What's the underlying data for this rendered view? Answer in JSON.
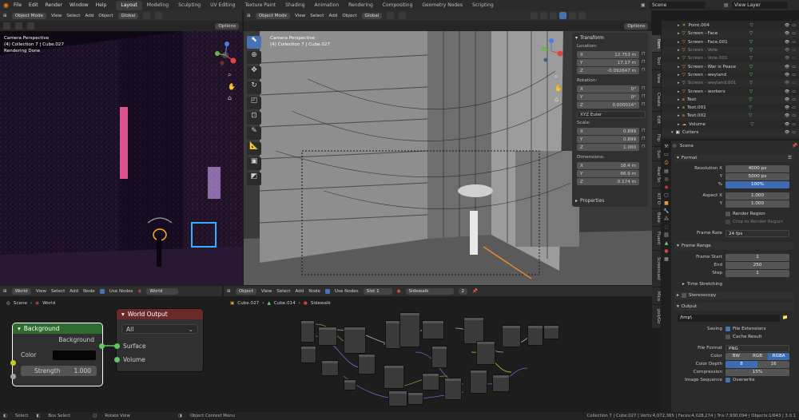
{
  "app": {
    "menu": [
      "File",
      "Edit",
      "Render",
      "Window",
      "Help"
    ],
    "workspaces": [
      "Layout",
      "Modeling",
      "Sculpting",
      "UV Editing",
      "Texture Paint",
      "Shading",
      "Animation",
      "Rendering",
      "Compositing",
      "Geometry Nodes",
      "Scripting"
    ],
    "active_workspace": "Layout",
    "scene": "Scene",
    "view_layer": "View Layer"
  },
  "left_viewport": {
    "mode": "Object Mode",
    "menu": [
      "View",
      "Select",
      "Add",
      "Object"
    ],
    "orientation": "Global",
    "options": "Options",
    "overlay": [
      "Camera Perspective",
      "(4) Collection 7 | Cube.027",
      "Rendering Done"
    ]
  },
  "center_viewport": {
    "mode": "Object Mode",
    "menu": [
      "View",
      "Select",
      "Add",
      "Object"
    ],
    "orientation": "Global",
    "options": "Options",
    "overlay": [
      "Camera Perspective",
      "(4) Collection 7 | Cube.027"
    ],
    "tabs": [
      "Item",
      "Tool",
      "View",
      "Create",
      "Edit",
      "Flip",
      "Sun",
      "Real Sn",
      "KIT O",
      "Bake",
      "Fluent",
      "Screencast",
      "Mica",
      "polyGo"
    ]
  },
  "transform": {
    "title": "Transform",
    "location_label": "Location:",
    "location": [
      {
        "axis": "X",
        "value": "12.753 m"
      },
      {
        "axis": "Y",
        "value": "17.17 m"
      },
      {
        "axis": "Z",
        "value": "-0.092647 m"
      }
    ],
    "rotation_label": "Rotation:",
    "rotation": [
      {
        "axis": "X",
        "value": "0°"
      },
      {
        "axis": "Y",
        "value": "0°"
      },
      {
        "axis": "Z",
        "value": "0.000014°"
      }
    ],
    "rotation_mode": "XYZ Euler",
    "scale_label": "Scale:",
    "scale": [
      {
        "axis": "X",
        "value": "0.899"
      },
      {
        "axis": "Y",
        "value": "0.899"
      },
      {
        "axis": "Z",
        "value": "1.000"
      }
    ],
    "dimensions_label": "Dimensions:",
    "dimensions": [
      {
        "axis": "X",
        "value": "18.4 m"
      },
      {
        "axis": "Y",
        "value": "66.9 m"
      },
      {
        "axis": "Z",
        "value": "0.174 m"
      }
    ],
    "properties": "Properties"
  },
  "outliner": {
    "items": [
      {
        "name": "Point.004",
        "type": "light"
      },
      {
        "name": "Screen - Face",
        "type": "mesh"
      },
      {
        "name": "Screen - Face.001",
        "type": "mesh"
      },
      {
        "name": "Screen - Vote",
        "type": "mesh",
        "dim": true
      },
      {
        "name": "Screen - Vote.001",
        "type": "mesh",
        "dim": true
      },
      {
        "name": "Screen - War is Peace",
        "type": "mesh"
      },
      {
        "name": "Screen - weyland",
        "type": "mesh"
      },
      {
        "name": "Screen - weyland.001",
        "type": "mesh",
        "dim": true
      },
      {
        "name": "Screen - workers",
        "type": "mesh"
      },
      {
        "name": "Text",
        "type": "text"
      },
      {
        "name": "Text.001",
        "type": "text"
      },
      {
        "name": "Text.002",
        "type": "text"
      },
      {
        "name": "Volume",
        "type": "volume"
      },
      {
        "name": "Cutters",
        "type": "collection"
      }
    ]
  },
  "properties": {
    "scene": "Scene",
    "format_title": "Format",
    "resolution_x_label": "Resolution X",
    "resolution_x": "4000 px",
    "y_label": "Y",
    "resolution_y": "5000 px",
    "pct_label": "%",
    "resolution_pct": "100%",
    "aspect_x_label": "Aspect X",
    "aspect_x": "1.000",
    "aspect_y": "1.000",
    "render_region": "Render Region",
    "crop_region": "Crop to Render Region",
    "frame_rate_label": "Frame Rate",
    "frame_rate": "24 fps",
    "frame_range_title": "Frame Range",
    "frame_start_label": "Frame Start",
    "frame_start": "1",
    "end_label": "End",
    "frame_end": "250",
    "step_label": "Step",
    "frame_step": "1",
    "time_stretching": "Time Stretching",
    "stereoscopy": "Stereoscopy",
    "output_title": "Output",
    "output_path": "/tmp\\",
    "saving_label": "Saving",
    "file_extensions": "File Extensions",
    "cache_result": "Cache Result",
    "file_format_label": "File Format",
    "file_format": "PNG",
    "color_label": "Color",
    "color_options": [
      "BW",
      "RGB",
      "RGBA"
    ],
    "color_active": "RGBA",
    "color_depth_label": "Color Depth",
    "color_depth": [
      "8",
      "16"
    ],
    "compression_label": "Compression",
    "compression": "15%",
    "image_sequence_label": "Image Sequence",
    "overwrite": "Overwrite"
  },
  "world_editor": {
    "type": "World",
    "menu": [
      "View",
      "Select",
      "Add",
      "Node"
    ],
    "use_nodes": "Use Nodes",
    "world_name": "World",
    "breadcrumb": [
      "Scene",
      "World"
    ],
    "background_node": {
      "title": "Background",
      "output": "Background",
      "color_label": "Color",
      "strength_label": "Strength",
      "strength": "1.000"
    },
    "output_node": {
      "title": "World Output",
      "target": "All",
      "surface": "Surface",
      "volume": "Volume"
    }
  },
  "shader_editor": {
    "type": "Object",
    "menu": [
      "View",
      "Select",
      "Add",
      "Node"
    ],
    "use_nodes": "Use Nodes",
    "slot": "Slot 1",
    "material": "Sidewalk",
    "users": "2",
    "breadcrumb": [
      "Cube.027",
      "Cube.014",
      "Sidewalk"
    ]
  },
  "status_bar": {
    "left": [
      "Select",
      "Box Select",
      "Rotate View",
      "Object Context Menu"
    ],
    "right": "Collection 7 | Cube.027 | Verts:4,072,365 | Faces:4,028,274 | Tris:7,930,094 | Objects:1/643 | 3.0.1"
  },
  "colors": {
    "accent": "#4772b3",
    "background_node_header": "#2f6b2f",
    "output_node_header": "#6b2a2a",
    "socket_green": "#63c763",
    "socket_yellow": "#c7c729",
    "socket_grey": "#a1a1a1"
  }
}
